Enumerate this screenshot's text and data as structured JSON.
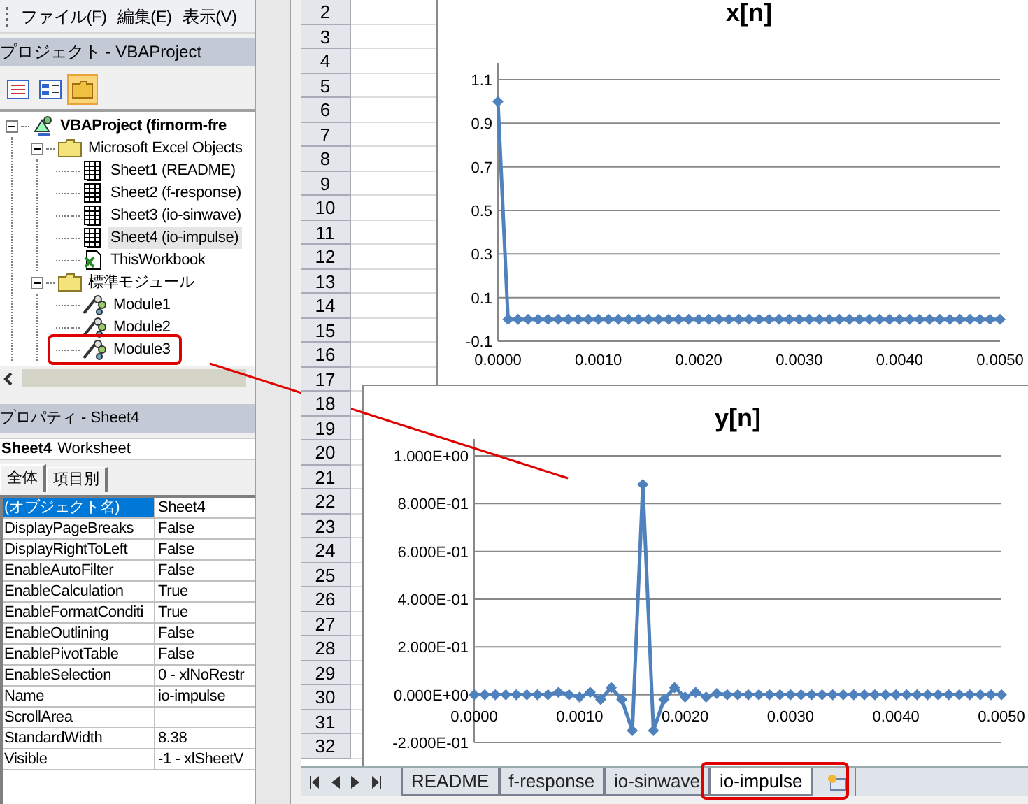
{
  "menu": [
    {
      "label": "ファイル(F)"
    },
    {
      "label": "編集(E)"
    },
    {
      "label": "表示(V)"
    }
  ],
  "project_panel": {
    "title": "プロジェクト - VBAProject",
    "toolbar": [
      {
        "kind": "view-code",
        "selected": false
      },
      {
        "kind": "view-object",
        "selected": false
      },
      {
        "kind": "toggle-folders",
        "selected": true
      }
    ],
    "tree": [
      {
        "label": "VBAProject (firnorm-fre",
        "kind": "project",
        "expanded": true,
        "selected": false,
        "children": [
          {
            "label": "Microsoft Excel Objects",
            "kind": "folder",
            "expanded": true,
            "selected": false,
            "children": [
              {
                "label": "Sheet1 (README)",
                "kind": "sheet",
                "selected": false
              },
              {
                "label": "Sheet2 (f-response)",
                "kind": "sheet",
                "selected": false
              },
              {
                "label": "Sheet3 (io-sinwave)",
                "kind": "sheet",
                "selected": false
              },
              {
                "label": "Sheet4 (io-impulse)",
                "kind": "sheet",
                "selected": true
              },
              {
                "label": "ThisWorkbook",
                "kind": "workbook",
                "selected": false
              }
            ]
          },
          {
            "label": "標準モジュール",
            "kind": "folder",
            "expanded": true,
            "selected": false,
            "children": [
              {
                "label": "Module1",
                "kind": "module",
                "selected": false
              },
              {
                "label": "Module2",
                "kind": "module",
                "selected": false
              },
              {
                "label": "Module3",
                "kind": "module",
                "selected": false,
                "annotated": true
              }
            ]
          }
        ]
      }
    ]
  },
  "properties_panel": {
    "title": "プロパティ - Sheet4",
    "object": {
      "name": "Sheet4",
      "type": "Worksheet"
    },
    "tabs": [
      {
        "label": "全体",
        "selected": true
      },
      {
        "label": "項目別",
        "selected": false
      }
    ],
    "rows": [
      {
        "name": "(オブジェクト名)",
        "value": "Sheet4",
        "selected": true
      },
      {
        "name": "DisplayPageBreaks",
        "value": "False",
        "selected": false
      },
      {
        "name": "DisplayRightToLeft",
        "value": "False",
        "selected": false
      },
      {
        "name": "EnableAutoFilter",
        "value": "False",
        "selected": false
      },
      {
        "name": "EnableCalculation",
        "value": "True",
        "selected": false
      },
      {
        "name": "EnableFormatConditi",
        "value": "True",
        "selected": false
      },
      {
        "name": "EnableOutlining",
        "value": "False",
        "selected": false
      },
      {
        "name": "EnablePivotTable",
        "value": "False",
        "selected": false
      },
      {
        "name": "EnableSelection",
        "value": "0 - xlNoRestr",
        "selected": false
      },
      {
        "name": "Name",
        "value": "io-impulse",
        "selected": false
      },
      {
        "name": "ScrollArea",
        "selected": false
      },
      {
        "name": "StandardWidth",
        "value": "8.38",
        "selected": false
      },
      {
        "name": "Visible",
        "value": "-1 - xlSheetV",
        "selected": false
      }
    ]
  },
  "sheet": {
    "rows": [
      "2",
      "3",
      "4",
      "5",
      "6",
      "7",
      "8",
      "9",
      "10",
      "11",
      "12",
      "13",
      "14",
      "15",
      "16",
      "17",
      "18",
      "19",
      "20",
      "21",
      "22",
      "23",
      "24",
      "25",
      "26",
      "27",
      "28",
      "29",
      "30",
      "31",
      "32"
    ],
    "charts": [
      {
        "chart_data": {
          "type": "line",
          "title": "x[n]",
          "x": [
            0,
            0.0001,
            0.0002,
            0.0003,
            0.0004,
            0.0005,
            0.0006,
            0.0007,
            0.0008,
            0.0009,
            0.001,
            0.0011,
            0.0012,
            0.0013,
            0.0014,
            0.0015,
            0.0016,
            0.0017,
            0.0018,
            0.0019,
            0.002,
            0.0021,
            0.0022,
            0.0023,
            0.0024,
            0.0025,
            0.0026,
            0.0027,
            0.0028,
            0.0029,
            0.003,
            0.0031,
            0.0032,
            0.0033,
            0.0034,
            0.0035,
            0.0036,
            0.0037,
            0.0038,
            0.0039,
            0.004,
            0.0041,
            0.0042,
            0.0043,
            0.0044,
            0.0045,
            0.0046,
            0.0047,
            0.0048,
            0.0049,
            0.005
          ],
          "grid": true,
          "series": [
            {
              "color": "#4f81bd",
              "marker": "diamond",
              "values": [
                1,
                0,
                0,
                0,
                0,
                0,
                0,
                0,
                0,
                0,
                0,
                0,
                0,
                0,
                0,
                0,
                0,
                0,
                0,
                0,
                0,
                0,
                0,
                0,
                0,
                0,
                0,
                0,
                0,
                0,
                0,
                0,
                0,
                0,
                0,
                0,
                0,
                0,
                0,
                0,
                0,
                0,
                0,
                0,
                0,
                0,
                0,
                0,
                0,
                0,
                0
              ]
            }
          ],
          "xlim": [
            0,
            0.005
          ],
          "ylim": [
            -0.1,
            1.1
          ],
          "xticks": [
            {
              "value": 0,
              "label": "0.0000"
            },
            {
              "value": 0.001,
              "label": "0.0010"
            },
            {
              "value": 0.002,
              "label": "0.0020"
            },
            {
              "value": 0.003,
              "label": "0.0030"
            },
            {
              "value": 0.004,
              "label": "0.0040"
            },
            {
              "value": 0.005,
              "label": "0.0050"
            }
          ],
          "yticks": [
            {
              "value": -0.1,
              "label": "-0.1"
            },
            {
              "value": 0.1,
              "label": "0.1"
            },
            {
              "value": 0.3,
              "label": "0.3"
            },
            {
              "value": 0.5,
              "label": "0.5"
            },
            {
              "value": 0.7,
              "label": "0.7"
            },
            {
              "value": 0.9,
              "label": "0.9"
            },
            {
              "value": 1.1,
              "label": "1.1"
            }
          ]
        }
      },
      {
        "chart_data": {
          "type": "line",
          "title": "y[n]",
          "x": [
            0,
            0.0001,
            0.0002,
            0.0003,
            0.0004,
            0.0005,
            0.0006,
            0.0007,
            0.0008,
            0.0009,
            0.001,
            0.0011,
            0.0012,
            0.0013,
            0.0014,
            0.0015,
            0.0016,
            0.0017,
            0.0018,
            0.0019,
            0.002,
            0.0021,
            0.0022,
            0.0023,
            0.0024,
            0.0025,
            0.0026,
            0.0027,
            0.0028,
            0.0029,
            0.003,
            0.0031,
            0.0032,
            0.0033,
            0.0034,
            0.0035,
            0.0036,
            0.0037,
            0.0038,
            0.0039,
            0.004,
            0.0041,
            0.0042,
            0.0043,
            0.0044,
            0.0045,
            0.0046,
            0.0047,
            0.0048,
            0.0049,
            0.005
          ],
          "grid": true,
          "series": [
            {
              "color": "#4f81bd",
              "marker": "diamond",
              "values": [
                0,
                0,
                0,
                0,
                0,
                0,
                0,
                0,
                0.01,
                0,
                -0.01,
                0.01,
                -0.02,
                0.03,
                -0.02,
                -0.15,
                0.88,
                -0.15,
                -0.02,
                0.03,
                -0.01,
                0.01,
                -0.01,
                0.005,
                0,
                0,
                0,
                0,
                0,
                0,
                0,
                0,
                0,
                0,
                0,
                0,
                0,
                0,
                0,
                0,
                0,
                0,
                0,
                0,
                0,
                0,
                0,
                0,
                0,
                0,
                0
              ]
            }
          ],
          "xlim": [
            0,
            0.005
          ],
          "ylim": [
            -0.2,
            1.0
          ],
          "xticks": [
            {
              "value": 0,
              "label": "0.0000"
            },
            {
              "value": 0.001,
              "label": "0.0010"
            },
            {
              "value": 0.002,
              "label": "0.0020"
            },
            {
              "value": 0.003,
              "label": "0.0030"
            },
            {
              "value": 0.004,
              "label": "0.0040"
            },
            {
              "value": 0.005,
              "label": "0.0050"
            }
          ],
          "yticks": [
            {
              "value": -0.2,
              "label": "-2.000E-01"
            },
            {
              "value": 0,
              "label": "0.000E+00"
            },
            {
              "value": 0.2,
              "label": "2.000E-01"
            },
            {
              "value": 0.4,
              "label": "4.000E-01"
            },
            {
              "value": 0.6,
              "label": "6.000E-01"
            },
            {
              "value": 0.8,
              "label": "8.000E-01"
            },
            {
              "value": 1.0,
              "label": "1.000E+00"
            }
          ]
        }
      }
    ],
    "sheet_tabs": [
      {
        "label": "README",
        "selected": false,
        "annotated": false
      },
      {
        "label": "f-response",
        "selected": false,
        "annotated": false
      },
      {
        "label": "io-sinwave",
        "selected": false,
        "annotated": false
      },
      {
        "label": "io-impulse",
        "selected": true,
        "annotated": true
      }
    ]
  }
}
